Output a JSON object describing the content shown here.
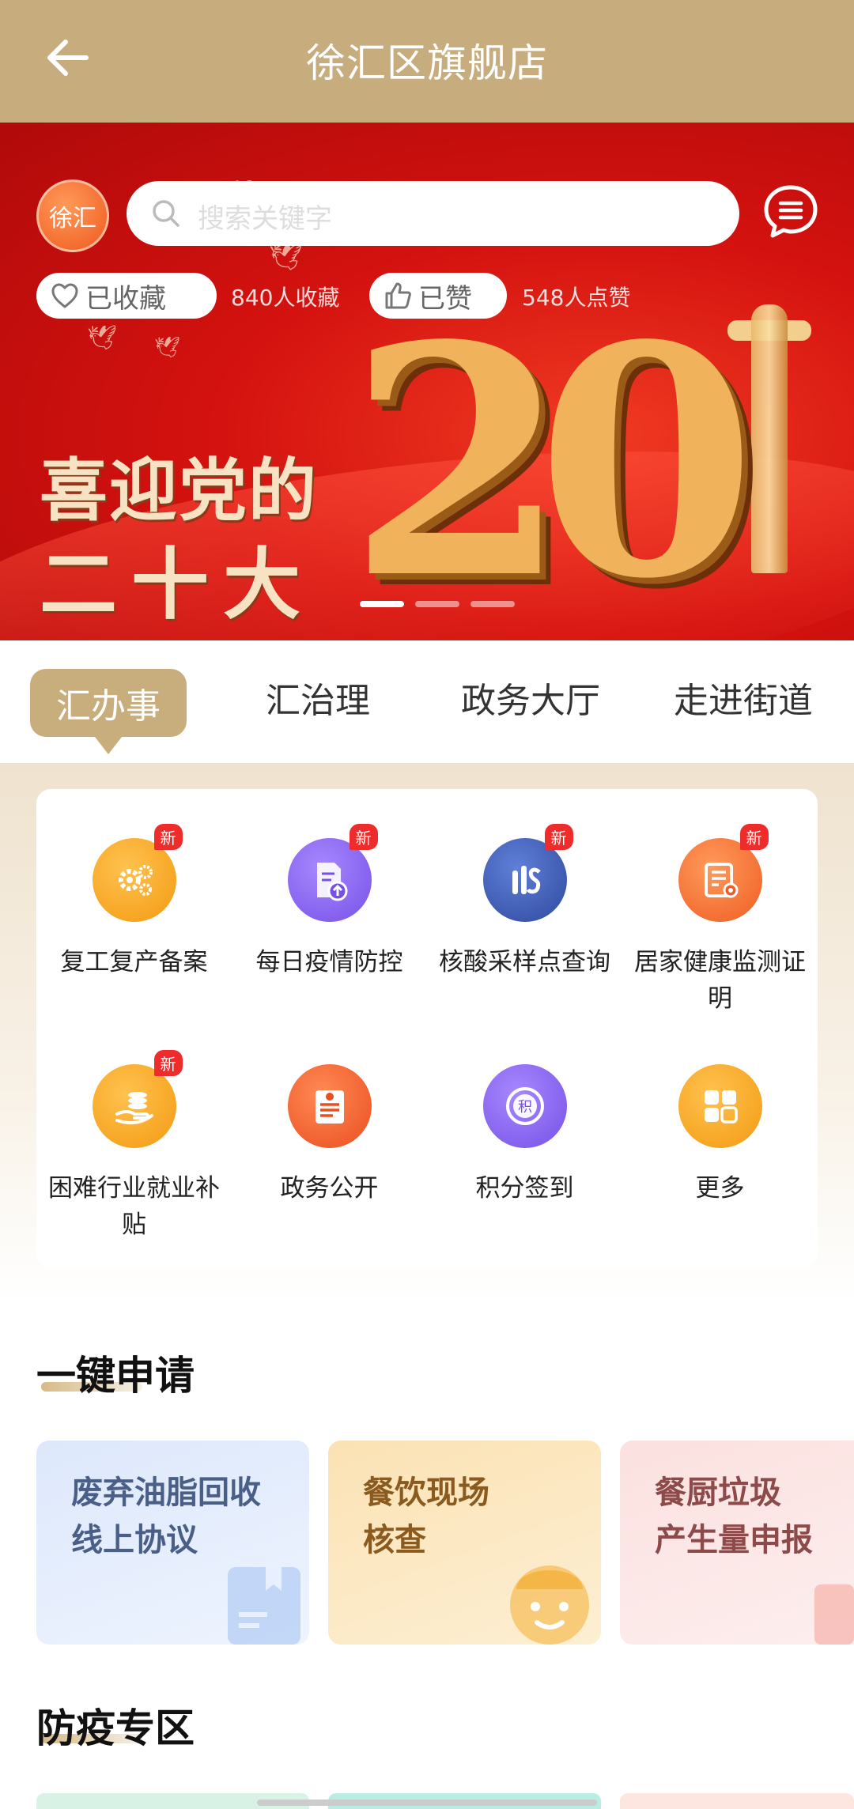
{
  "header": {
    "title": "徐汇区旗舰店"
  },
  "banner": {
    "logo_text": "徐汇",
    "search_placeholder": "搜索关键字",
    "favorite_label": "已收藏",
    "favorite_count": "840人收藏",
    "like_label": "已赞",
    "like_count": "548人点赞",
    "slogan_line1": "喜迎党的",
    "slogan_line2": "二十大",
    "big_number": "20",
    "slides_total": 3,
    "slide_active": 1
  },
  "tabs": [
    "汇办事",
    "汇治理",
    "政务大厅",
    "走进街道"
  ],
  "services": [
    {
      "label": "复工复产备案",
      "icon": "gears-icon",
      "badge": "新",
      "color": "#f7a51c"
    },
    {
      "label": "每日疫情防控",
      "icon": "document-upload-icon",
      "badge": "新",
      "color": "#8a63ee"
    },
    {
      "label": "核酸采样点查询",
      "icon": "test-tube-icon",
      "badge": "新",
      "color": "#3d59b0"
    },
    {
      "label": "居家健康监测证明",
      "icon": "certificate-icon",
      "badge": "新",
      "color": "#f06a2e"
    },
    {
      "label": "困难行业就业补贴",
      "icon": "coins-hand-icon",
      "badge": "新",
      "color": "#f7a51c"
    },
    {
      "label": "政务公开",
      "icon": "news-icon",
      "badge": "",
      "color": "#f0612e"
    },
    {
      "label": "积分签到",
      "icon": "points-icon",
      "badge": "",
      "color": "#8a63ee"
    },
    {
      "label": "更多",
      "icon": "grid-icon",
      "badge": "",
      "color": "#f7a51c"
    }
  ],
  "section1": {
    "title": "一键申请",
    "cards": [
      {
        "line1": "废弃油脂回收",
        "line2": "线上协议",
        "icon": "book-icon"
      },
      {
        "line1": "餐饮现场",
        "line2": "核查",
        "icon": "chef-icon"
      },
      {
        "line1": "餐厨垃圾",
        "line2": "产生量申报",
        "icon": "trash-icon"
      }
    ]
  },
  "section2": {
    "title": "防疫专区"
  }
}
